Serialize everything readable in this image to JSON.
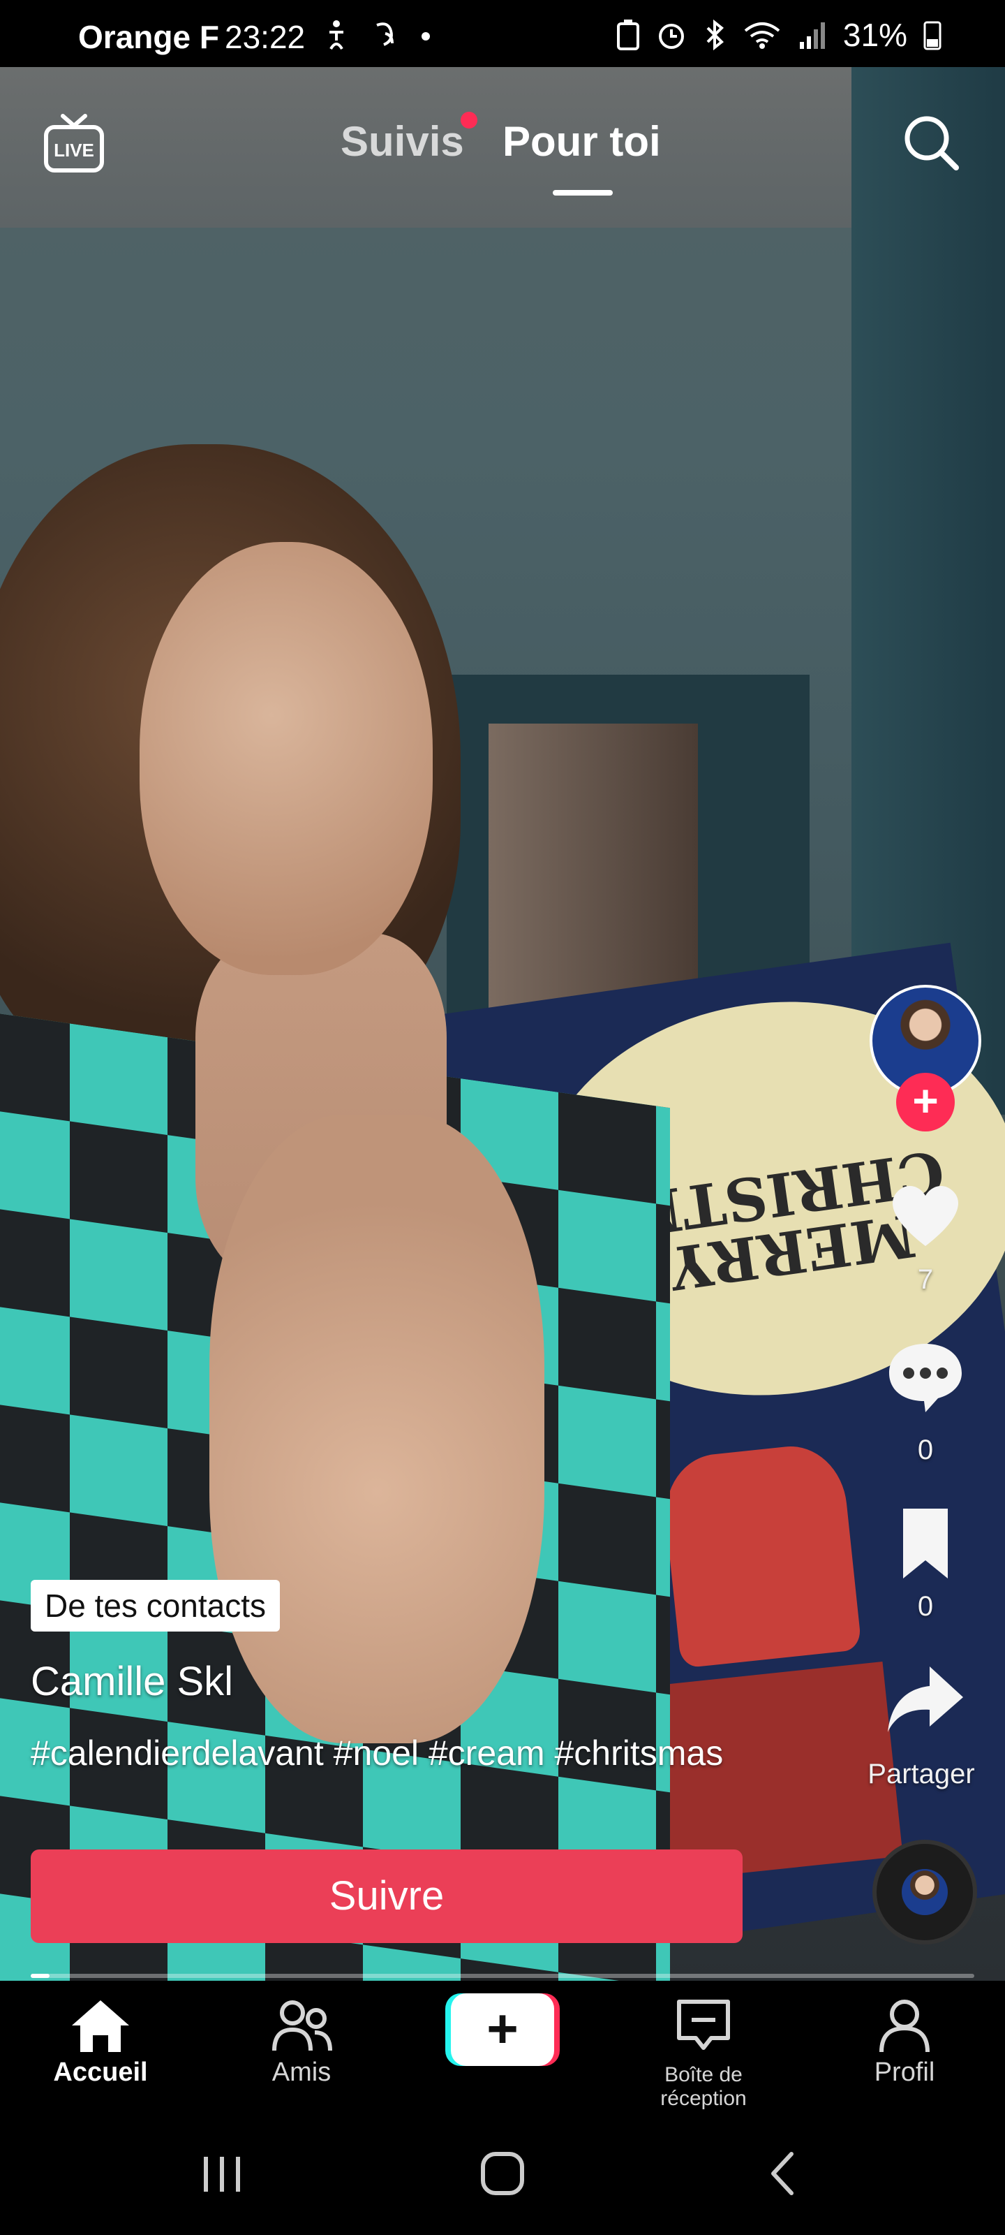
{
  "status_bar": {
    "carrier": "Orange F",
    "time": "23:22",
    "battery": "31%"
  },
  "top_nav": {
    "tab_following": "Suivis",
    "tab_for_you": "Pour toi",
    "live_label": "LIVE"
  },
  "video": {
    "box_text_line1": "MERRY",
    "box_text_line2": "CHRISTMAS"
  },
  "right_rail": {
    "likes": "7",
    "comments": "0",
    "saves": "0",
    "share_label": "Partager"
  },
  "caption": {
    "badge": "De tes contacts",
    "username": "Camille  Skl",
    "text": "#calendierdelavant #noel #cream #chritsmas",
    "follow_label": "Suivre"
  },
  "playback": {
    "progress": 0.02
  },
  "bottom_nav": {
    "home": "Accueil",
    "friends": "Amis",
    "inbox": "Boîte de réception",
    "profile": "Profil",
    "create": "+"
  },
  "colors": {
    "accent": "#fe2c55",
    "follow_button": "#eb3f57",
    "create_cyan": "#25f4ee"
  }
}
